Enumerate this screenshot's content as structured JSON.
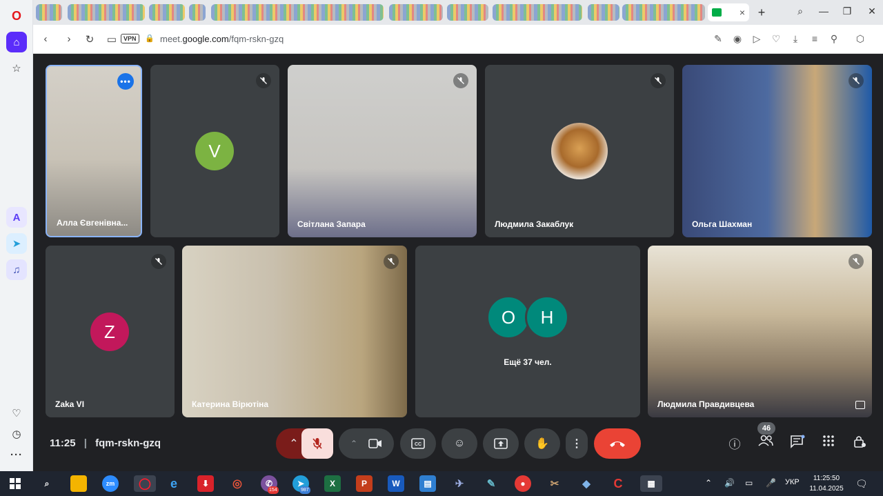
{
  "browser": {
    "url_prefix": "meet.",
    "url_domain": "google.com",
    "url_path": "/fqm-rskn-gzq",
    "vpn_label": "VPN"
  },
  "meeting": {
    "time": "11:25",
    "code": "fqm-rskn-gzq",
    "participant_count": "46",
    "more_text": "Ещё 37 чел."
  },
  "participants": [
    {
      "name": "Алла Євгенівна...",
      "kind": "video",
      "active": true
    },
    {
      "name": "",
      "kind": "avatar",
      "initial": "V",
      "color": "#7cb342"
    },
    {
      "name": "Світлана Запара",
      "kind": "video"
    },
    {
      "name": "Людмила Закаблук",
      "kind": "avatar-photo"
    },
    {
      "name": "Ольга Шахман",
      "kind": "video"
    },
    {
      "name": "Zaka VI",
      "kind": "avatar",
      "initial": "Z",
      "color": "#c2185b"
    },
    {
      "name": "Катерина Вірютіна",
      "kind": "video"
    },
    {
      "name": "",
      "kind": "group",
      "initials": [
        "O",
        "H"
      ],
      "color": "#00897b"
    },
    {
      "name": "Людмила Правдивцева",
      "kind": "video"
    }
  ],
  "taskbar": {
    "language": "УКР",
    "time": "11:25:50",
    "date": "11.04.2025",
    "viber_badge": "154",
    "telegram_badge": "987"
  },
  "colors": {
    "accent": "#1a73e8",
    "end_call": "#ea4335",
    "opera_home": "#5b2dfa"
  }
}
